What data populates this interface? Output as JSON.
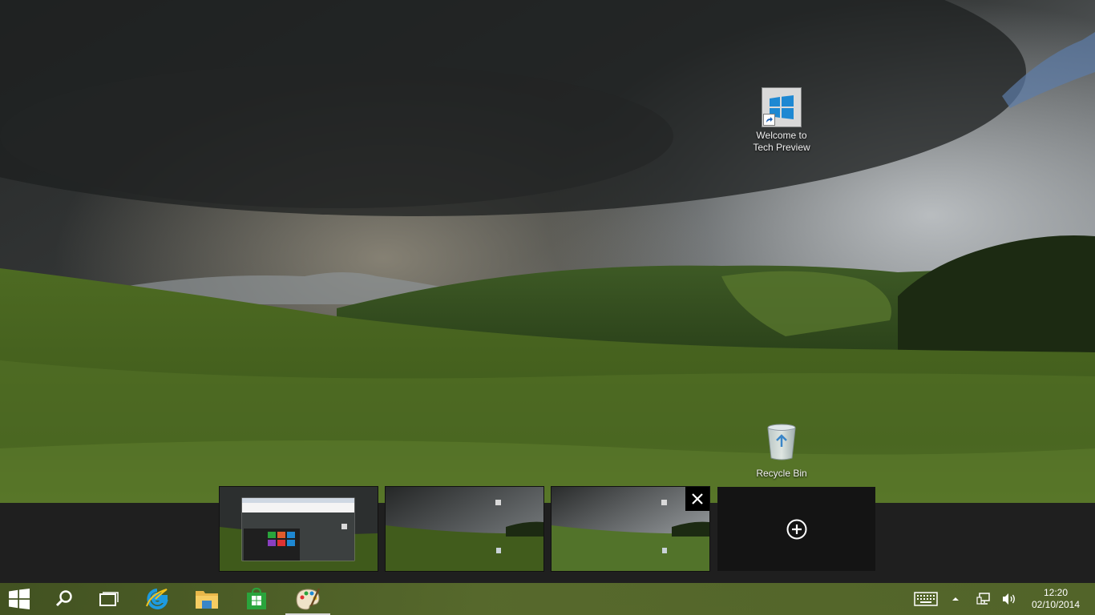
{
  "desktop": {
    "icons": [
      {
        "label_line1": "Welcome to",
        "label_line2": "Tech Preview",
        "icon": "windows-logo-shortcut-icon"
      },
      {
        "label": "Recycle Bin",
        "icon": "recycle-bin-icon"
      }
    ]
  },
  "task_view": {
    "desktops": [
      {
        "name": "desktop-1",
        "content": "paint-and-start-menu"
      },
      {
        "name": "desktop-2",
        "content": "wallpaper"
      },
      {
        "name": "desktop-3",
        "content": "wallpaper",
        "hovered": true
      }
    ],
    "close_icon": "close-icon",
    "add_icon": "plus-circle-icon"
  },
  "taskbar": {
    "buttons": [
      {
        "name": "start",
        "icon": "windows-logo-icon"
      },
      {
        "name": "search",
        "icon": "search-icon"
      },
      {
        "name": "task-view",
        "icon": "task-view-icon"
      },
      {
        "name": "internet-explorer",
        "icon": "internet-explorer-icon"
      },
      {
        "name": "file-explorer",
        "icon": "folder-icon"
      },
      {
        "name": "store",
        "icon": "store-icon"
      },
      {
        "name": "paint",
        "icon": "paint-palette-icon",
        "active": true
      }
    ],
    "tray": {
      "icons": [
        "keyboard-icon",
        "chevron-up-icon",
        "network-icon",
        "volume-icon"
      ],
      "time": "12:20",
      "date": "02/10/2014"
    }
  },
  "colors": {
    "taskbar": "#4e5c28",
    "taskview_band": "#1f1f1f",
    "win_blue": "#1e88d2",
    "store_green": "#2aa43c"
  }
}
